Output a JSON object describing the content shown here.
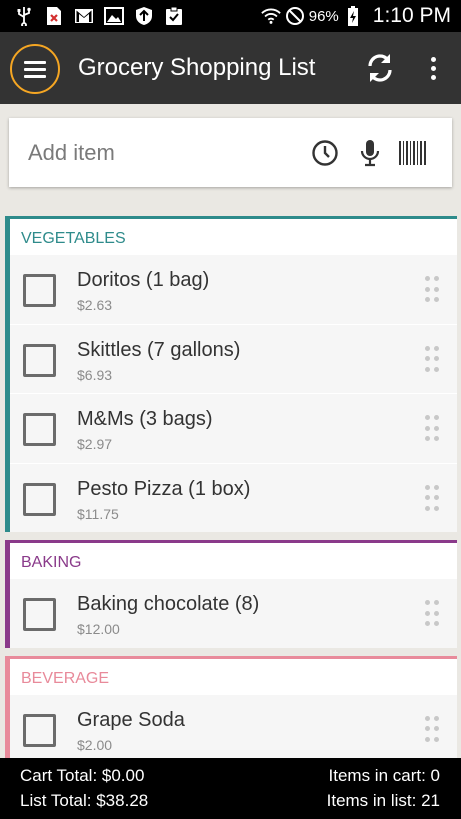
{
  "status_bar": {
    "icons": [
      "usb-icon",
      "error-icon",
      "gmail-icon",
      "image-icon",
      "shield-icon",
      "clipboard-icon"
    ],
    "wifi_icon": "wifi-icon",
    "dnd_icon": "do-not-disturb-icon",
    "battery_percent": "96%",
    "battery_icon": "battery-charging-icon",
    "time": "1:10 PM"
  },
  "app_bar": {
    "title": "Grocery Shopping List",
    "menu_icon": "hamburger-menu-icon",
    "sync_icon": "sync-icon",
    "more_icon": "more-vert-icon",
    "highlight_color": "#f5a623",
    "background": "#333333"
  },
  "add_item": {
    "placeholder": "Add item",
    "value": "",
    "icons": [
      "history-icon",
      "microphone-icon",
      "barcode-icon"
    ]
  },
  "sections": [
    {
      "name": "VEGETABLES",
      "color": "#2e8b8b",
      "items": [
        {
          "name": "Doritos (1 bag)",
          "price": "$2.63",
          "checked": false
        },
        {
          "name": "Skittles (7 gallons)",
          "price": "$6.93",
          "checked": false
        },
        {
          "name": "M&Ms (3 bags)",
          "price": "$2.97",
          "checked": false
        },
        {
          "name": "Pesto Pizza (1 box)",
          "price": "$11.75",
          "checked": false
        }
      ]
    },
    {
      "name": "BAKING",
      "color": "#8a3a8a",
      "items": [
        {
          "name": "Baking chocolate (8)",
          "price": "$12.00",
          "checked": false
        }
      ]
    },
    {
      "name": "BEVERAGE",
      "color": "#e88a9a",
      "items": [
        {
          "name": "Grape Soda",
          "price": "$2.00",
          "checked": false
        }
      ]
    }
  ],
  "footer": {
    "cart_total": "Cart Total: $0.00",
    "list_total": "List Total: $38.28",
    "items_in_cart": "Items in cart: 0",
    "items_in_list": "Items in list: 21"
  }
}
